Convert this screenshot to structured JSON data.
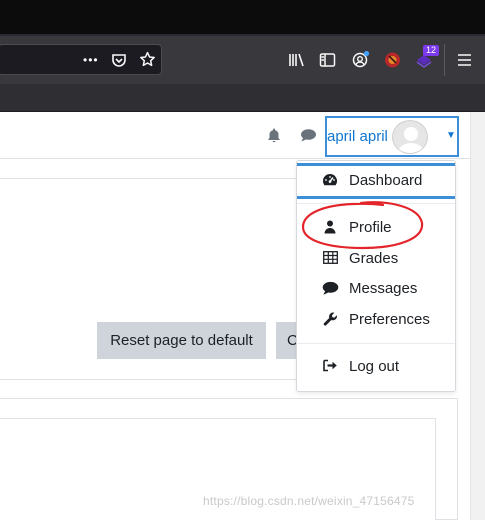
{
  "browser": {
    "more_icon": "•••",
    "pocket_icon": "pocket-icon",
    "bookmark_icon": "star-icon",
    "library_icon": "library-icon",
    "sidebar_icon": "sidebar-icon",
    "account_icon": "account-icon",
    "extension_badge": "12",
    "menu_icon": "hamburger-menu-icon"
  },
  "header": {
    "user_name": "april april",
    "notification_icon": "bell-icon",
    "messages_icon": "speech-bubble-icon",
    "caret_icon": "caret-down-icon"
  },
  "main": {
    "reset_button": "Reset page to default",
    "second_button": "C"
  },
  "user_menu": {
    "items": [
      {
        "label": "Dashboard",
        "icon": "tachometer-icon"
      },
      {
        "label": "Profile",
        "icon": "user-icon"
      },
      {
        "label": "Grades",
        "icon": "table-icon"
      },
      {
        "label": "Messages",
        "icon": "comment-icon"
      },
      {
        "label": "Preferences",
        "icon": "wrench-icon"
      },
      {
        "label": "Log out",
        "icon": "sign-out-icon"
      }
    ]
  },
  "watermark": "https://blog.csdn.net/weixin_47156475",
  "colors": {
    "accent": "#3b8fd6",
    "link": "#1177d1",
    "annotation": "#e3252b",
    "button": "#ced4da",
    "chrome_dark": "#0c0c0d",
    "toolbar": "#38383d"
  }
}
